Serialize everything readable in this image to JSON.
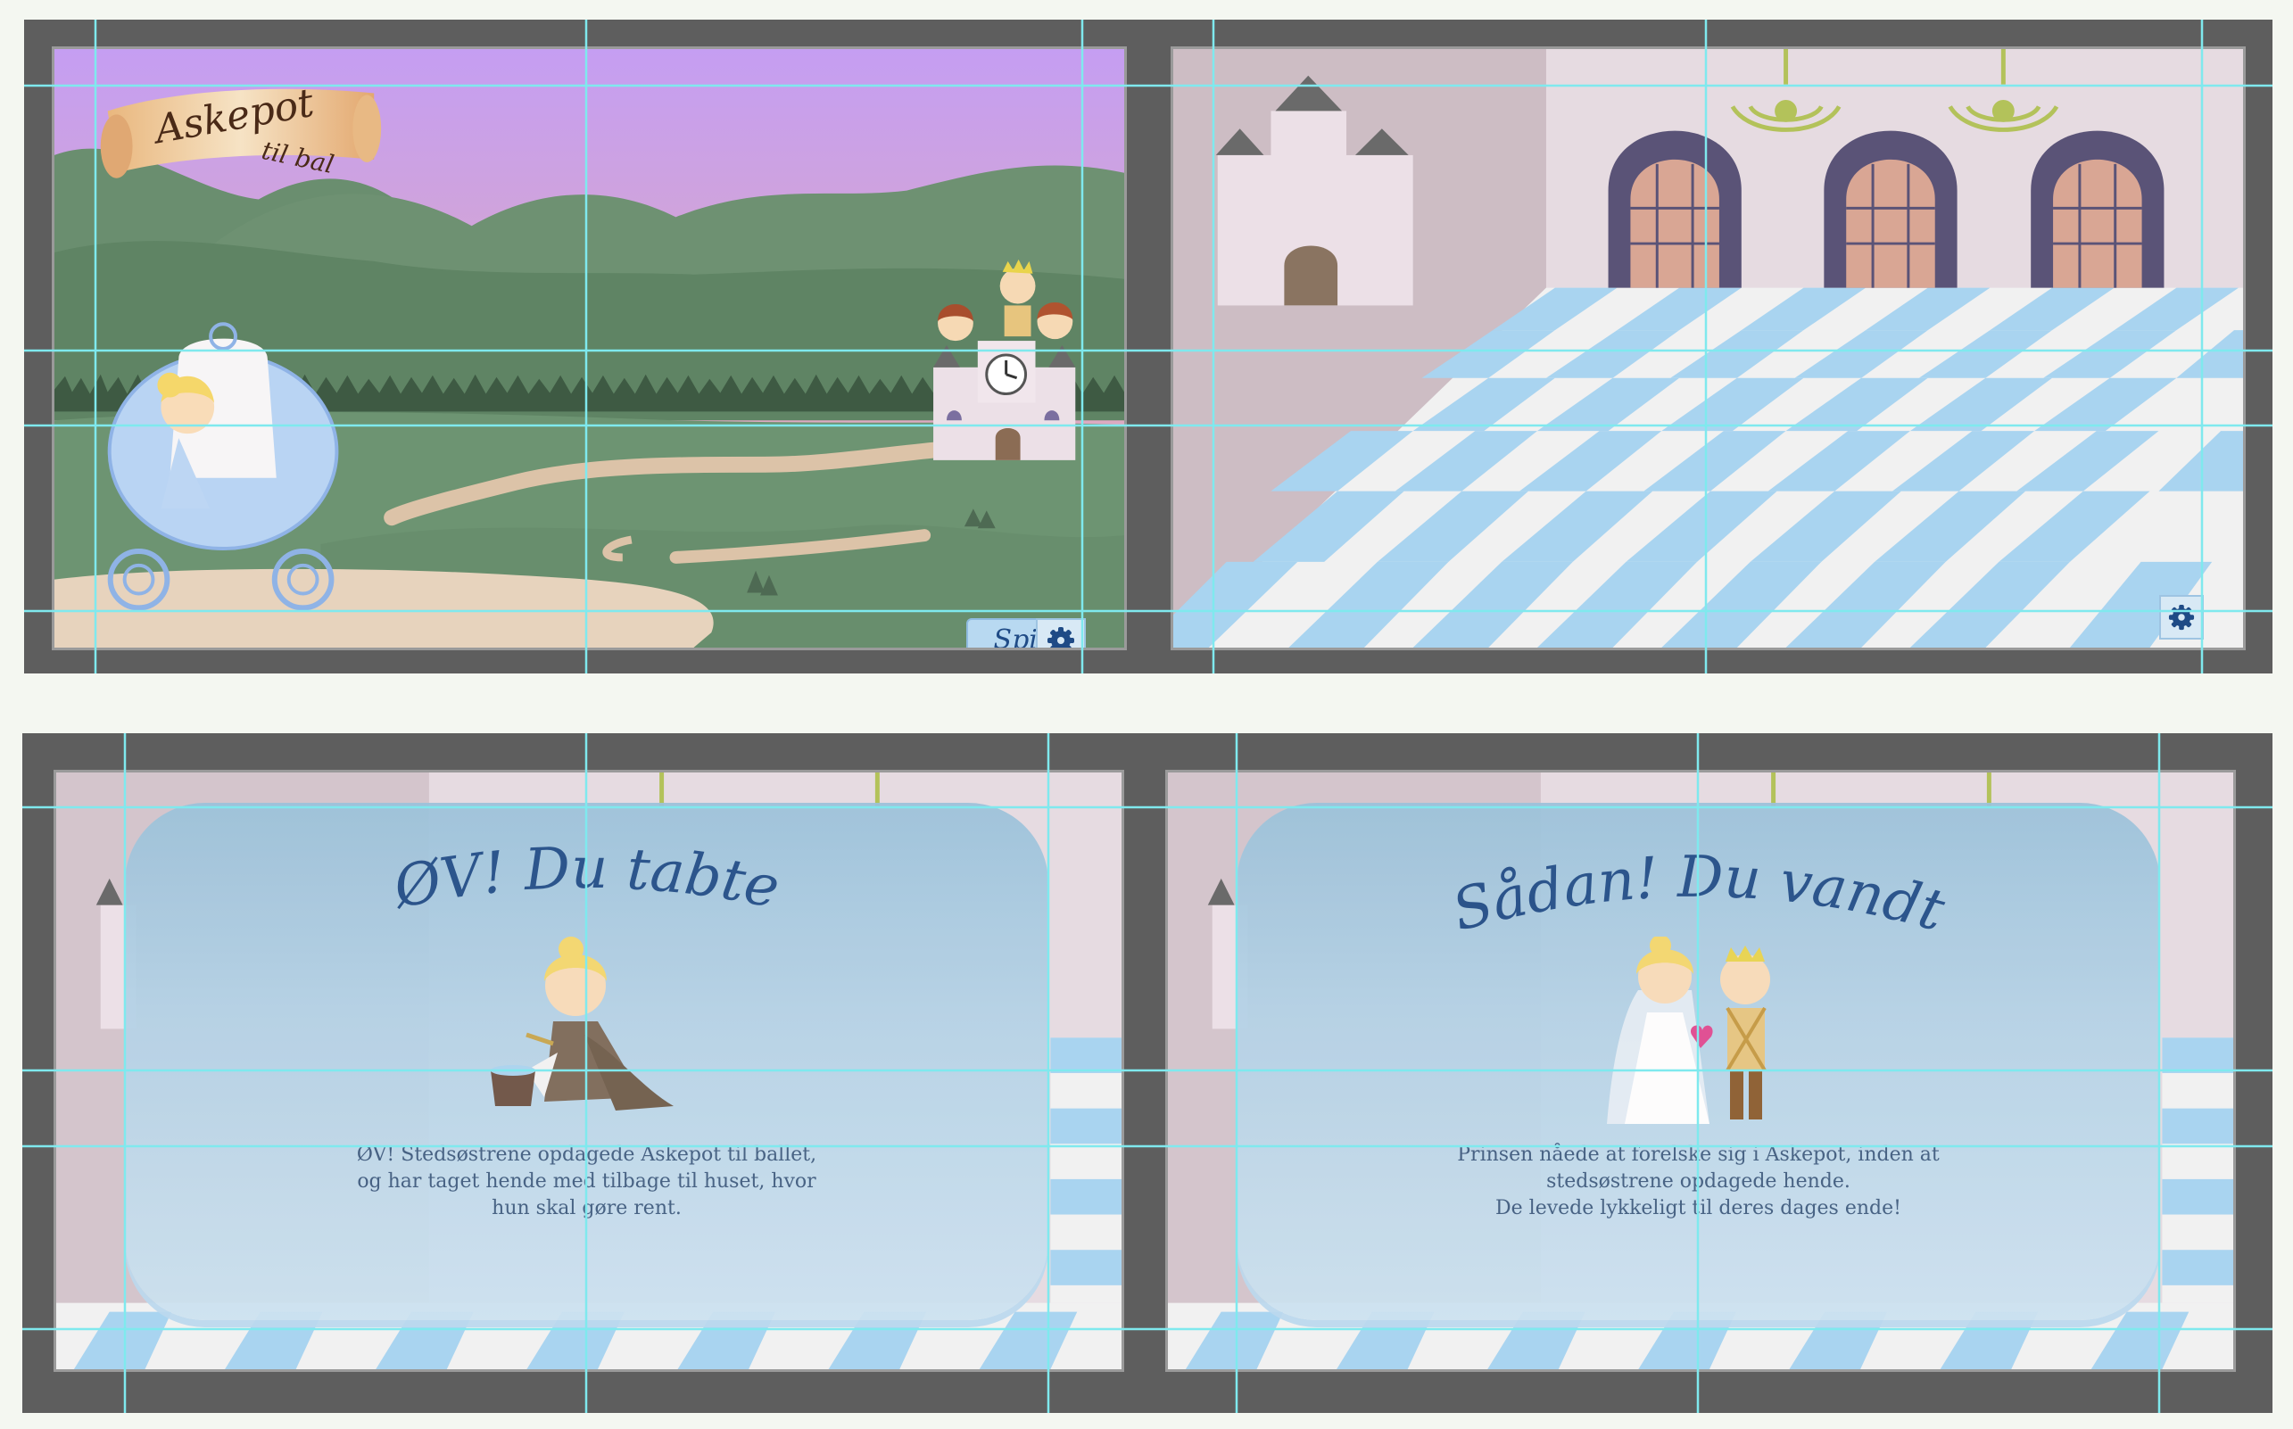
{
  "game": {
    "title_main": "Askepot",
    "title_sub": "til bal",
    "play_label": "Spil",
    "settings_icon": "gear-icon"
  },
  "lose_screen": {
    "title": "ØV! Du tabte",
    "message": "ØV! Stedsøstrene opdagede Askepot til ballet,\nog har taget hende med tilbage til huset, hvor\nhun skal gøre rent."
  },
  "win_screen": {
    "title": "Sådan! Du vandt",
    "message": "Prinsen nåede at forelske sig i Askepot, inden at\nstedsøstrene opdagede hende.\nDe levede lykkeligt til deres dages ende!"
  },
  "colors": {
    "frame": "#5e5e5e",
    "guide": "#7fe9ee",
    "sky_top": "#c59ef2",
    "sky_bottom": "#eab1a4",
    "accent_blue": "#1f4b86",
    "tile_blue": "#a9d4f0",
    "tile_white": "#f1f1f1",
    "hall_wall": "#e6dbe1",
    "curtain": "#5a5377",
    "chandelier": "#b3c25a"
  }
}
